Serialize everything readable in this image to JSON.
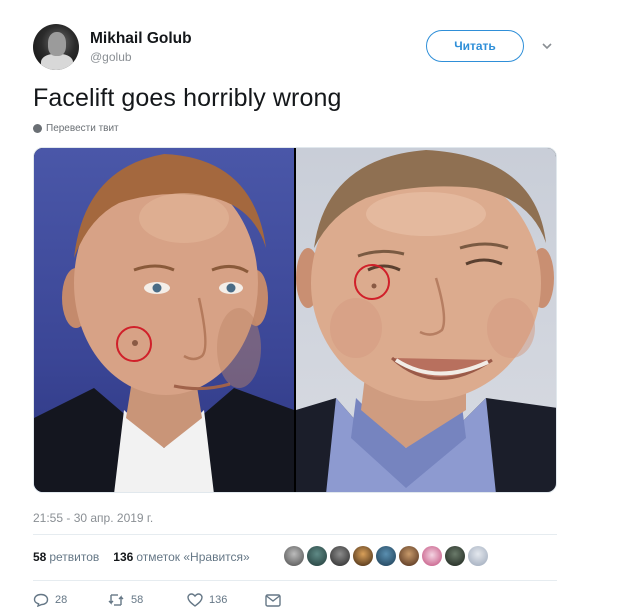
{
  "author": {
    "display_name": "Mikhail Golub",
    "handle": "@golub"
  },
  "follow_button_label": "Читать",
  "tweet": {
    "text": "Facelift goes horribly wrong",
    "translate_label": "Перевести твит",
    "timestamp": "21:55 - 30 апр. 2019 г."
  },
  "stats": {
    "retweets_count": "58",
    "retweets_label": "ретвитов",
    "likes_count": "136",
    "likes_label": "отметок «Нравится»"
  },
  "actions": {
    "reply_count": "28",
    "retweet_count": "58",
    "like_count": "136"
  },
  "colors": {
    "accent": "#2f8fd8",
    "circle_mark": "#d0202a"
  }
}
